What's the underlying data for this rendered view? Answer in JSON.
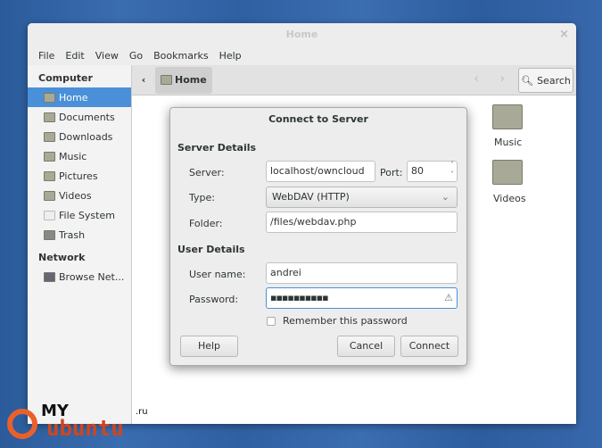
{
  "window": {
    "title": "Home",
    "close": "×"
  },
  "menu": [
    "File",
    "Edit",
    "View",
    "Go",
    "Bookmarks",
    "Help"
  ],
  "sidebar": {
    "computer_heading": "Computer",
    "items": [
      "Home",
      "Documents",
      "Downloads",
      "Music",
      "Pictures",
      "Videos",
      "File System",
      "Trash"
    ],
    "network_heading": "Network",
    "network_items": [
      "Browse Net..."
    ]
  },
  "toolbar": {
    "back": "‹",
    "crumb": "Home",
    "nav": "‹ ›",
    "search": "Search"
  },
  "content": {
    "folders": [
      "Music",
      "Videos"
    ]
  },
  "dialog": {
    "title": "Connect to Server",
    "server_section": "Server Details",
    "server_label": "Server:",
    "server_value": "localhost/owncloud",
    "port_label": "Port:",
    "port_value": "80",
    "type_label": "Type:",
    "type_value": "WebDAV (HTTP)",
    "folder_label": "Folder:",
    "folder_value": "/files/webdav.php",
    "user_section": "User Details",
    "username_label": "User name:",
    "username_value": "andrei",
    "password_label": "Password:",
    "password_value": "▪▪▪▪▪▪▪▪▪▪",
    "remember_label": "Remember this password",
    "help": "Help",
    "cancel": "Cancel",
    "connect": "Connect"
  },
  "watermark": {
    "my": "MY",
    "ubuntu": "ubuntu",
    "ru": ".ru"
  }
}
